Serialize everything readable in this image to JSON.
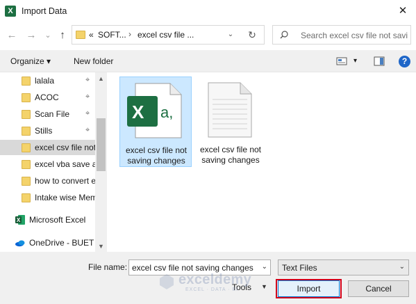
{
  "window": {
    "title": "Import Data",
    "close_glyph": "✕",
    "app_icon_letter": "X"
  },
  "nav": {
    "back_glyph": "←",
    "forward_glyph": "→",
    "history_glyph": "⌄",
    "up_glyph": "↑"
  },
  "address": {
    "prefix": "«",
    "crumbs": [
      "SOFT...",
      "excel csv file ..."
    ],
    "separator": "›",
    "dropdown_glyph": "⌄",
    "refresh_glyph": "↻"
  },
  "search": {
    "placeholder": "Search excel csv file not savi..."
  },
  "toolbar": {
    "organize_label": "Organize ▾",
    "new_folder_label": "New folder",
    "view_arrow": "▾",
    "help_glyph": "?"
  },
  "sidebar": {
    "items": [
      {
        "label": "lalala",
        "pinned": true
      },
      {
        "label": "ACOC",
        "pinned": true
      },
      {
        "label": "Scan File",
        "pinned": true
      },
      {
        "label": "Stills",
        "pinned": true
      },
      {
        "label": "excel csv file not",
        "pinned": false,
        "selected": true
      },
      {
        "label": "excel vba save as",
        "pinned": false
      },
      {
        "label": "how to convert e",
        "pinned": false
      },
      {
        "label": "Intake wise Mem",
        "pinned": false
      }
    ],
    "pin_glyph": "📌",
    "excel_label": "Microsoft Excel",
    "onedrive_label": "OneDrive - BUET",
    "scroll_up": "▲",
    "scroll_down": "▼"
  },
  "files": [
    {
      "name": "excel csv file not saving changes",
      "icon": "excel-csv-icon",
      "selected": true,
      "glyph_x": "X",
      "glyph_a": "a,"
    },
    {
      "name": "excel csv file not saving changes",
      "icon": "text-file-icon",
      "selected": false
    }
  ],
  "footer": {
    "file_name_label": "File name:",
    "file_name_value": "excel csv file not saving changes",
    "file_type_value": "Text Files",
    "chevron": "⌄",
    "tools_label": "Tools",
    "tools_arrow": "▼",
    "import_label": "Import",
    "cancel_label": "Cancel"
  },
  "watermark": {
    "text": "exceldemy",
    "subtext": "EXCEL · DATA · BI"
  },
  "colors": {
    "accent": "#0078d7",
    "highlight_outline": "#d0021b",
    "excel_green": "#1d6f42",
    "folder": "#f4d36b"
  }
}
